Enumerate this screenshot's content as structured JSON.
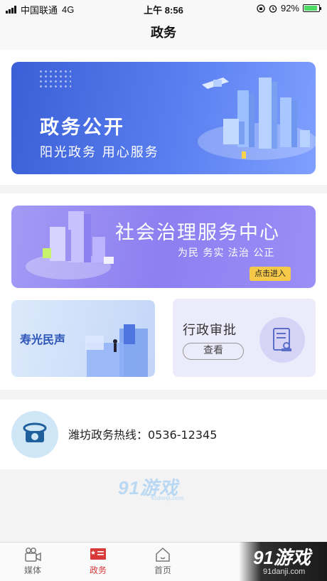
{
  "status_bar": {
    "carrier": "中国联通",
    "network": "4G",
    "time": "上午 8:56",
    "battery_percent_text": "92%",
    "battery_level": 0.92
  },
  "nav": {
    "title": "政务"
  },
  "gov_open_banner": {
    "title": "政务公开",
    "subtitle": "阳光政务  用心服务"
  },
  "social_service": {
    "title": "社会治理服务中心",
    "subtitle": "为民 务实 法治 公正",
    "button": "点击进入"
  },
  "voice_card": {
    "label": "寿光民声"
  },
  "approval_card": {
    "label": "行政审批",
    "button": "查看"
  },
  "hotline": {
    "text": "潍坊政务热线：0536-12345"
  },
  "watermark": {
    "brand": "91游戏",
    "domain": "91danji.com"
  },
  "tabbar": {
    "items": [
      {
        "label": "媒体",
        "icon": "video-camera-icon",
        "active": false
      },
      {
        "label": "政务",
        "icon": "gov-flag-icon",
        "active": true
      },
      {
        "label": "首页",
        "icon": "home-icon",
        "active": false
      }
    ]
  },
  "corner_watermark": {
    "brand": "91游戏",
    "domain": "91danji.com"
  },
  "colors": {
    "accent": "#d83a3a",
    "banner_blue": "#3a5fd6",
    "social_purple": "#8d7ff0",
    "enter_yellow": "#f7c948"
  }
}
